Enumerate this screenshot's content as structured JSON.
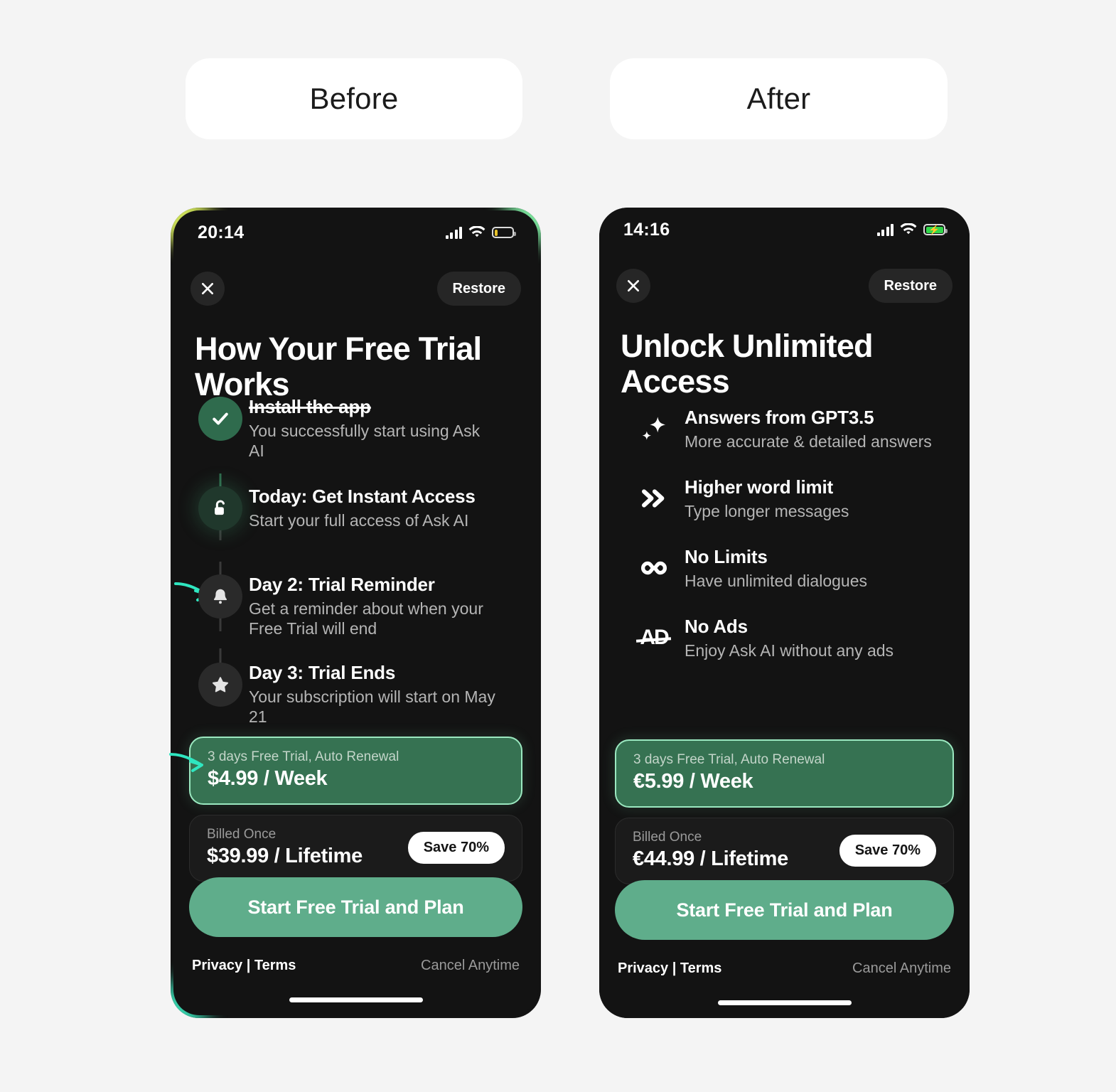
{
  "labels": {
    "before": "Before",
    "after": "After"
  },
  "before_screen": {
    "status": {
      "time": "20:14",
      "battery_state": "low",
      "signal_icon": "signal-bars-icon",
      "wifi_icon": "wifi-icon",
      "battery_icon": "battery-low-icon"
    },
    "close_label": "close-icon",
    "restore_label": "Restore",
    "headline": "How Your Free Trial Works",
    "steps": [
      {
        "icon": "check-icon",
        "state": "done",
        "title": "Install the app",
        "struck": true,
        "desc": "You successfully start using Ask AI"
      },
      {
        "icon": "unlock-icon",
        "state": "active",
        "title": "Today: Get Instant Access",
        "struck": false,
        "desc": "Start your full access of Ask AI"
      },
      {
        "icon": "bell-icon",
        "state": "idle",
        "title": "Day 2: Trial Reminder",
        "struck": false,
        "desc": "Get a reminder about when  your Free Trial will end"
      },
      {
        "icon": "star-icon",
        "state": "idle",
        "title": "Day 3: Trial Ends",
        "struck": false,
        "desc": "Your subscription will start on May 21"
      }
    ],
    "plans": [
      {
        "sub": "3 days Free Trial, Auto Renewal",
        "price": "$4.99 / Week",
        "selected": true,
        "badge": ""
      },
      {
        "sub": "Billed Once",
        "price": "$39.99 / Lifetime",
        "selected": false,
        "badge": "Save 70%"
      }
    ],
    "cta": "Start Free Trial and Plan",
    "footer_left": "Privacy | Terms",
    "footer_right": "Cancel Anytime"
  },
  "after_screen": {
    "status": {
      "time": "14:16",
      "battery_state": "charging",
      "signal_icon": "signal-bars-icon",
      "wifi_icon": "wifi-icon",
      "battery_icon": "battery-charging-icon"
    },
    "close_label": "close-icon",
    "restore_label": "Restore",
    "headline": "Unlock Unlimited Access",
    "features": [
      {
        "icon": "sparkle-icon",
        "title": "Answers from GPT3.5",
        "desc": "More accurate & detailed answers"
      },
      {
        "icon": "double-chevron-right-icon",
        "title": "Higher word limit",
        "desc": "Type longer messages"
      },
      {
        "icon": "infinity-icon",
        "title": "No Limits",
        "desc": "Have unlimited dialogues"
      },
      {
        "icon": "no-ads-icon",
        "title": "No Ads",
        "desc": "Enjoy Ask AI without any ads"
      }
    ],
    "plans": [
      {
        "sub": "3 days Free Trial, Auto Renewal",
        "price": "€5.99 / Week",
        "selected": true,
        "badge": ""
      },
      {
        "sub": "Billed Once",
        "price": "€44.99 / Lifetime",
        "selected": false,
        "badge": "Save 70%"
      }
    ],
    "cta": "Start Free Trial and Plan",
    "footer_left": "Privacy | Terms",
    "footer_right": "Cancel Anytime"
  },
  "annotations": [
    {
      "name": "arrow-to-trial-reminder",
      "color": "#2fe6c0"
    },
    {
      "name": "arrow-to-weekly-plan",
      "color": "#2fe6c0"
    }
  ],
  "colors": {
    "page_bg": "#f4f4f4",
    "phone_bg": "#131313",
    "accent_green": "#5fad8b",
    "selected_card": "#367252",
    "selected_border": "#9be8c0",
    "arrow_teal": "#2fe6c0",
    "glow_yellow": "#d4e85c",
    "glow_green": "#7ee8a0",
    "glow_teal": "#39d6b0"
  }
}
